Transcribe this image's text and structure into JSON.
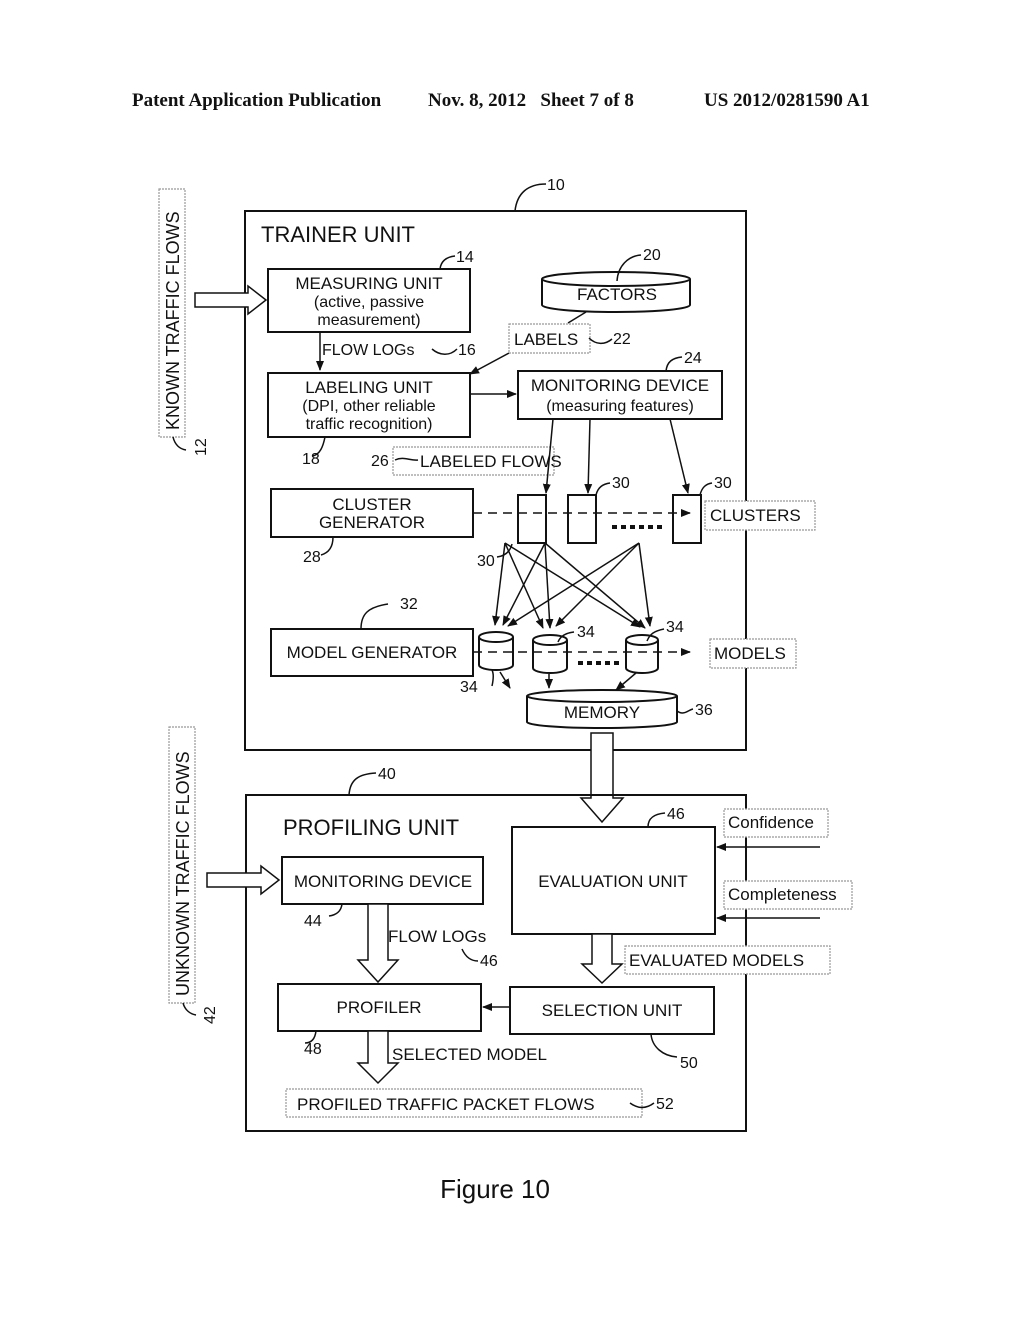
{
  "header": {
    "publication": "Patent Application Publication",
    "date_sheet": "Nov. 8, 2012   Sheet 7 of 8",
    "number": "US 2012/0281590 A1"
  },
  "trainer": {
    "ref": "10",
    "title": "TRAINER UNIT",
    "input_label": "KNOWN TRAFFIC FLOWS",
    "input_ref": "12",
    "measuring_unit": {
      "lines": [
        "MEASURING UNIT",
        "(active, passive",
        "measurement)"
      ],
      "ref": "14"
    },
    "factors": {
      "label": "FACTORS",
      "ref": "20"
    },
    "labels": {
      "label": "LABELS",
      "ref": "22"
    },
    "flow_logs": {
      "label": "FLOW LOGs",
      "ref": "16"
    },
    "labeling_unit": {
      "lines": [
        "LABELING UNIT",
        "(DPI, other reliable",
        "traffic recognition)"
      ],
      "ref": "18"
    },
    "monitoring_device": {
      "lines": [
        "MONITORING DEVICE",
        "(measuring features)"
      ],
      "ref": "24"
    },
    "labeled_flows": {
      "label": "LABELED FLOWS",
      "ref": "26"
    },
    "cluster_generator": {
      "lines": [
        "CLUSTER",
        "GENERATOR"
      ],
      "ref": "28"
    },
    "cluster_ref": "30",
    "clusters_label": "CLUSTERS",
    "model_generator": {
      "label": "MODEL GENERATOR",
      "ref": "32"
    },
    "model_ref": "34",
    "models_label": "MODELS",
    "memory": {
      "label": "MEMORY",
      "ref": "36"
    }
  },
  "profiling": {
    "ref": "40",
    "title": "PROFILING UNIT",
    "input_label": "UNKNOWN TRAFFIC FLOWS",
    "input_ref": "42",
    "monitoring_device": {
      "label": "MONITORING DEVICE",
      "ref": "44"
    },
    "evaluation_unit": {
      "label": "EVALUATION UNIT",
      "ref": "46"
    },
    "confidence": "Confidence",
    "completeness": "Completeness",
    "flow_logs": {
      "label": "FLOW LOGs",
      "ref": "46"
    },
    "evaluated_models": "EVALUATED MODELS",
    "profiler": {
      "label": "PROFILER",
      "ref": "48"
    },
    "selection_unit": {
      "label": "SELECTION UNIT",
      "ref": "50"
    },
    "selected_model": "SELECTED MODEL",
    "profiled_flows": {
      "label": "PROFILED TRAFFIC PACKET FLOWS",
      "ref": "52"
    }
  },
  "caption": "Figure 10"
}
